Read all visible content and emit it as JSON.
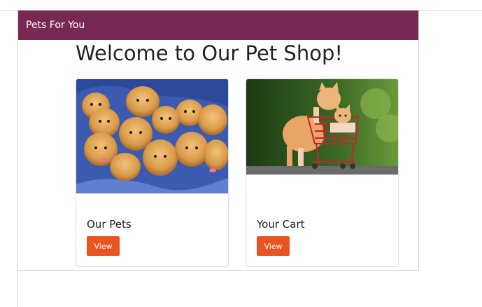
{
  "navbar": {
    "brand": "Pets For You"
  },
  "main": {
    "heading": "Welcome to Our Pet Shop!",
    "cards": [
      {
        "title": "Our Pets",
        "button_label": "View",
        "image": "puppies-photo"
      },
      {
        "title": "Your Cart",
        "button_label": "View",
        "image": "kittens-shopping-cart-photo"
      }
    ]
  },
  "colors": {
    "navbar_bg": "#772953",
    "button_bg": "#e95420"
  }
}
